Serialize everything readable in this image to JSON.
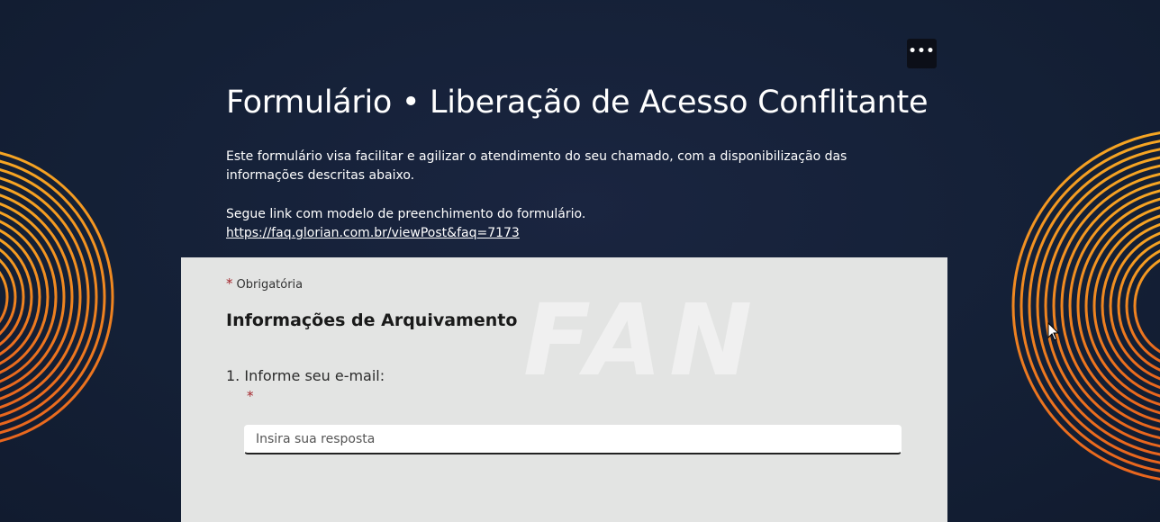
{
  "header": {
    "more_options_label": "•••",
    "more_options_icon": "more-horizontal-icon"
  },
  "form": {
    "title": "Formulário • Liberação de Acesso Conflitante",
    "description_line1": "Este formulário visa facilitar e agilizar o atendimento do seu chamado, com a disponibilização das informações descritas abaixo.",
    "description_line2": "Segue link com modelo de preenchimento do formulário.",
    "link_text": "https://faq.glorian.com.br/viewPost&faq=7173",
    "required_marker": "*",
    "required_label": "Obrigatória",
    "section_title": "Informações de Arquivamento",
    "questions": [
      {
        "label": "1. Informe seu e-mail:",
        "required_marker": "*",
        "placeholder": "Insira sua resposta",
        "value": ""
      }
    ]
  },
  "colors": {
    "background": "#16213a",
    "accent_orange": "#f39c1f",
    "card_background": "#e3e4e3",
    "required": "#a4262c"
  }
}
